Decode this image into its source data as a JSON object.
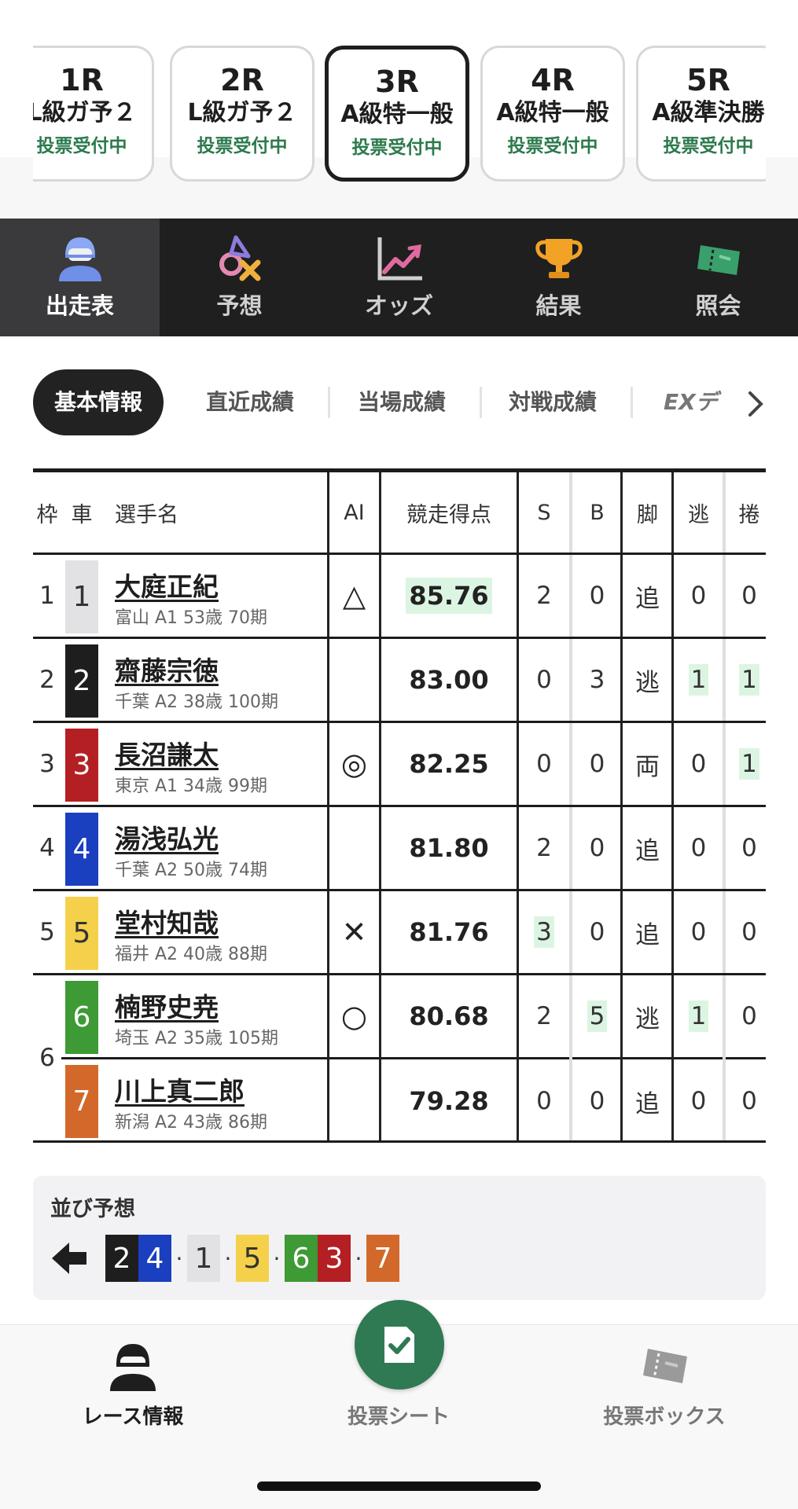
{
  "race_tabs": [
    {
      "num": "1R",
      "class": "L級ガ予２",
      "status": "投票受付中"
    },
    {
      "num": "2R",
      "class": "L級ガ予２",
      "status": "投票受付中"
    },
    {
      "num": "3R",
      "class": "A級特一般",
      "status": "投票受付中",
      "active": true
    },
    {
      "num": "4R",
      "class": "A級特一般",
      "status": "投票受付中"
    },
    {
      "num": "5R",
      "class": "A級準決勝",
      "status": "投票受付中"
    }
  ],
  "main_nav": [
    {
      "label": "出走表",
      "icon": "racer-icon",
      "active": true
    },
    {
      "label": "予想",
      "icon": "prediction-icon"
    },
    {
      "label": "オッズ",
      "icon": "odds-chart-icon"
    },
    {
      "label": "結果",
      "icon": "trophy-icon"
    },
    {
      "label": "照会",
      "icon": "ticket-icon"
    }
  ],
  "sub_tabs": [
    "基本情報",
    "直近成績",
    "当場成績",
    "対戦成績",
    "EXデ"
  ],
  "table": {
    "headers": {
      "waku": "枠",
      "car": "車",
      "name": "選手名",
      "ai": "AI",
      "score": "競走得点",
      "s": "S",
      "b": "B",
      "leg": "脚",
      "nige": "逃",
      "makuri": "捲"
    },
    "rows": [
      {
        "waku": "1",
        "car": "1",
        "name": "大庭正紀",
        "info": "富山 A1 53歳 70期",
        "ai": "△",
        "score": "85.76",
        "s": "2",
        "b": "0",
        "leg": "追",
        "nige": "0",
        "makuri": "0"
      },
      {
        "waku": "2",
        "car": "2",
        "name": "齋藤宗徳",
        "info": "千葉 A2 38歳 100期",
        "ai": "",
        "score": "83.00",
        "s": "0",
        "b": "3",
        "leg": "逃",
        "nige": "1",
        "makuri": "1"
      },
      {
        "waku": "3",
        "car": "3",
        "name": "長沼謙太",
        "info": "東京 A1 34歳 99期",
        "ai": "◎",
        "score": "82.25",
        "s": "0",
        "b": "0",
        "leg": "両",
        "nige": "0",
        "makuri": "1"
      },
      {
        "waku": "4",
        "car": "4",
        "name": "湯浅弘光",
        "info": "千葉 A2 50歳 74期",
        "ai": "",
        "score": "81.80",
        "s": "2",
        "b": "0",
        "leg": "追",
        "nige": "0",
        "makuri": "0"
      },
      {
        "waku": "5",
        "car": "5",
        "name": "堂村知哉",
        "info": "福井 A2 40歳 88期",
        "ai": "✕",
        "score": "81.76",
        "s": "3",
        "b": "0",
        "leg": "追",
        "nige": "0",
        "makuri": "0"
      },
      {
        "waku": "6",
        "car": "6",
        "name": "楠野史尭",
        "info": "埼玉 A2 35歳 105期",
        "ai": "○",
        "score": "80.68",
        "s": "2",
        "b": "5",
        "leg": "逃",
        "nige": "1",
        "makuri": "0"
      },
      {
        "waku": "",
        "car": "7",
        "name": "川上真二郎",
        "info": "新潟 A2 43歳 86期",
        "ai": "",
        "score": "79.28",
        "s": "0",
        "b": "0",
        "leg": "追",
        "nige": "0",
        "makuri": "0"
      }
    ]
  },
  "line_prediction": {
    "title": "並び予想",
    "sequence": [
      "2",
      "4",
      "·",
      "1",
      "·",
      "5",
      "·",
      "6",
      "3",
      "·",
      "7"
    ]
  },
  "colors": {
    "car1": "#e2e2e4",
    "car2": "#1e1e1e",
    "car3": "#b41f24",
    "car4": "#1a3fbf",
    "car5": "#f5d04a",
    "car6": "#3d9a34",
    "car7": "#d2692a",
    "status_green": "#2c7a4d"
  },
  "bottom_nav": [
    {
      "label": "レース情報",
      "icon": "racer-icon",
      "active": true
    },
    {
      "label": "投票シート",
      "icon": "vote-sheet-icon"
    },
    {
      "label": "投票ボックス",
      "icon": "ticket-icon"
    }
  ]
}
